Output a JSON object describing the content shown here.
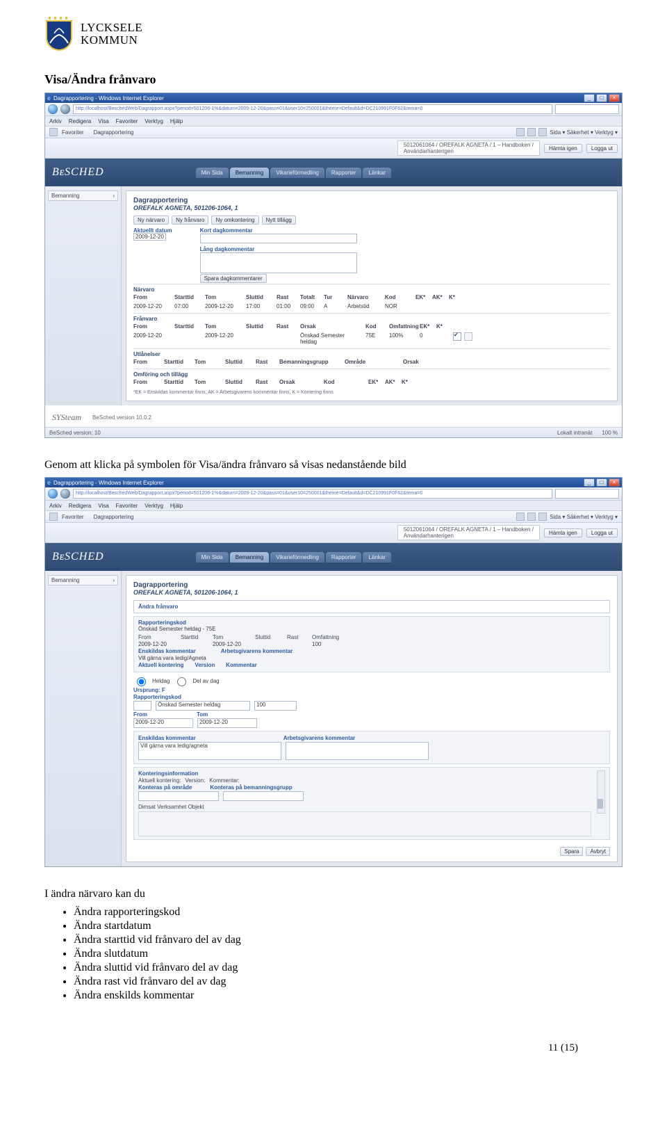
{
  "logo": {
    "line1": "LYCKSELE",
    "line2": "KOMMUN"
  },
  "heading": "Visa/Ändra frånvaro",
  "ie": {
    "title": "Dagrapportering - Windows Internet Explorer",
    "url": "http://localhost/BeschedWeb/Dagrapport.aspx?period=501206-1%&datum=2009-12-20&pass=01&user10=250001&theme=Default&d=DC210991F0F62&tema=0",
    "menu": [
      "Arkiv",
      "Redigera",
      "Visa",
      "Favoriter",
      "Verktyg",
      "Hjälp"
    ],
    "fav_label": "Favoriter",
    "tab_label": "Dagrapportering",
    "toolbar_right": "Sida ▾  Säkerhet ▾  Verktyg ▾",
    "status_left": "BeSched version: 10",
    "status_mid": "Lokalt intranät",
    "status_zoom": "100 %"
  },
  "app": {
    "user_line1": "5012061064 / OREFALK AGNETA / 1 – Handboken /",
    "user_line2": "Användarhanterigen",
    "btn_hamta": "Hämta igen",
    "btn_logout": "Logga ut",
    "brand": "BᴇSCHED",
    "tabs": [
      "Min Sida",
      "Bemanning",
      "Vikarieförmedling",
      "Rapporter",
      "Länkar"
    ],
    "rail": "Bemanning",
    "title": "Dagrapportering",
    "person": "OREFALK AGNETA, 501206-1064, 1"
  },
  "scr1": {
    "btns": [
      "Ny närvaro",
      "Ny frånvaro",
      "Ny omkontering",
      "Nytt tillägg"
    ],
    "date_lbl": "Aktuellt datum",
    "date_val": "2009-12-20",
    "comment_short_lbl": "Kort dagkommentar",
    "comment_long_lbl": "Lång dagkommentar",
    "save_btn": "Spara dagkommentarer",
    "narvaro_head": "Närvaro",
    "narvaro_cols": [
      "From",
      "Starttid",
      "Tom",
      "Sluttid",
      "Rast",
      "Totalt",
      "Tur",
      "Närvaro",
      "Kod",
      "EK*",
      "AK*",
      "K*"
    ],
    "narvaro_row": [
      "2009-12-20",
      "07:00",
      "2009-12-20",
      "17:00",
      "01:00",
      "09:00",
      "A",
      "Arbetstid",
      "NOR",
      "",
      "",
      ""
    ],
    "franvaro_head": "Frånvaro",
    "franvaro_cols": [
      "From",
      "Starttid",
      "Tom",
      "Sluttid",
      "Rast",
      "Orsak",
      "Kod",
      "Omfattning",
      "EK*",
      "K*",
      "",
      ""
    ],
    "franvaro_row": [
      "2009-12-20",
      "",
      "2009-12-20",
      "",
      "",
      "Önskad Semester heldag",
      "75E",
      "100%",
      "0",
      "",
      "",
      ""
    ],
    "ut_head": "Utlånelser",
    "ut_cols": [
      "From",
      "Starttid",
      "Tom",
      "Sluttid",
      "Rast",
      "Bemanningsgrupp",
      "Område",
      "Orsak"
    ],
    "om_head": "Omföring och tillägg",
    "om_cols": [
      "From",
      "Starttid",
      "Tom",
      "Sluttid",
      "Rast",
      "Orsak",
      "Kod",
      "EK*",
      "AK*",
      "K*"
    ],
    "footnote": "*EK = Enskildas kommentar finns, AK = Arbetsgivarens kommentar finns, K = Kontering finns",
    "systeam": "SYSteam",
    "version": "BeSched version 10.0.2"
  },
  "scr2": {
    "panel_head": "Ändra frånvaro",
    "rapkod_lbl": "Rapporteringskod",
    "rapkod_val": "Önskad Semester heldag - 75E",
    "cols1": [
      "From",
      "Starttid",
      "Tom",
      "Sluttid",
      "Rast",
      "Omfattning"
    ],
    "row1": [
      "2009-12-20",
      "",
      "2009-12-20",
      "",
      "",
      "100"
    ],
    "ensk_lbl": "Enskildas kommentar",
    "ensk_val": "Vill gärna vara ledig/Agneta",
    "arb_lbl": "Arbetsgivarens kommentar",
    "akt_lbl": "Aktuell kontering",
    "version_lbl": "Version",
    "kommentar_lbl": "Kommentar",
    "heldag_chk": "Heldag",
    "delav_chk": "Del av dag",
    "ursprung_lbl": "Ursprung: F",
    "rapkod2_lbl": "Rapporteringskod",
    "rapkod2_val": "Önskad Semester heldag",
    "pct": "100",
    "from_lbl": "From",
    "from_val": "2009-12-20",
    "tom_lbl": "Tom",
    "tom_val": "2009-12-20",
    "ensk2_lbl": "Enskildas kommentar",
    "ensk2_val": "Vill gärna vara ledig/agneta",
    "arb2_lbl": "Arbetsgivarens kommentar",
    "kontinfo_lbl": "Konteringsinformation",
    "akt2_lbl": "Aktuell kontering:",
    "ver2_lbl": "Version:",
    "kom2_lbl": "Kommentar:",
    "kontera_a": "Konteras på område",
    "kontera_b": "Konteras på bemanningsgrupp",
    "dim_lbl": "Dimsat  Verksamhet  Objekt",
    "btn_save": "Spara",
    "btn_cancel": "Avbryt"
  },
  "para": "Genom att klicka på symbolen för Visa/ändra frånvaro så visas nedanstående bild",
  "list_intro": "I ändra närvaro kan du",
  "bullets": [
    "Ändra rapporteringskod",
    "Ändra startdatum",
    "Ändra starttid vid frånvaro del av dag",
    "Ändra slutdatum",
    "Ändra sluttid vid frånvaro del av dag",
    "Ändra rast vid frånvaro del av dag",
    "Ändra enskilds kommentar"
  ],
  "page_num": "11 (15)"
}
